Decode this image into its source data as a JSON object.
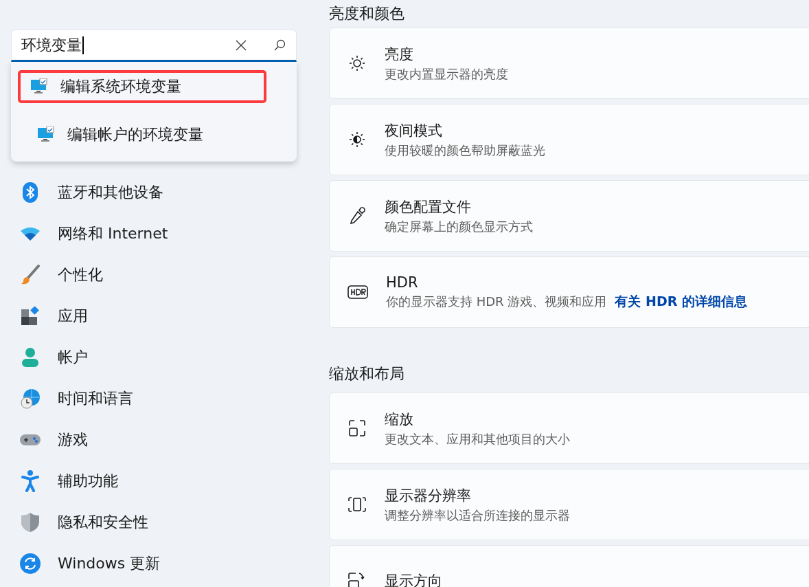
{
  "search": {
    "value": "环境变量",
    "results": [
      {
        "label": "编辑系统环境变量",
        "highlighted": true
      },
      {
        "label": "编辑帐户的环境变量",
        "highlighted": false
      }
    ]
  },
  "sidebar": {
    "items": [
      {
        "label": "蓝牙和其他设备",
        "kind": "bluetooth"
      },
      {
        "label": "网络和 Internet",
        "kind": "wifi"
      },
      {
        "label": "个性化",
        "kind": "brush"
      },
      {
        "label": "应用",
        "kind": "apps"
      },
      {
        "label": "帐户",
        "kind": "person"
      },
      {
        "label": "时间和语言",
        "kind": "globe"
      },
      {
        "label": "游戏",
        "kind": "gamepad"
      },
      {
        "label": "辅助功能",
        "kind": "accessibility"
      },
      {
        "label": "隐私和安全性",
        "kind": "shield"
      },
      {
        "label": "Windows 更新",
        "kind": "update"
      }
    ]
  },
  "sections": [
    {
      "heading": "亮度和颜色",
      "cards": [
        {
          "title": "亮度",
          "subtitle": "更改内置显示器的亮度",
          "kind": "sun"
        },
        {
          "title": "夜间模式",
          "subtitle": "使用较暖的颜色帮助屏蔽蓝光",
          "kind": "night"
        },
        {
          "title": "颜色配置文件",
          "subtitle": "确定屏幕上的颜色显示方式",
          "kind": "dropper"
        },
        {
          "title": "HDR",
          "subtitle": "你的显示器支持 HDR 游戏、视频和应用",
          "link": "有关 HDR 的详细信息",
          "kind": "hdr"
        }
      ]
    },
    {
      "heading": "缩放和布局",
      "cards": [
        {
          "title": "缩放",
          "subtitle": "更改文本、应用和其他项目的大小",
          "kind": "scale"
        },
        {
          "title": "显示器分辨率",
          "subtitle": "调整分辨率以适合所连接的显示器",
          "kind": "resolution"
        },
        {
          "title": "显示方向",
          "kind": "rotate"
        }
      ]
    }
  ]
}
